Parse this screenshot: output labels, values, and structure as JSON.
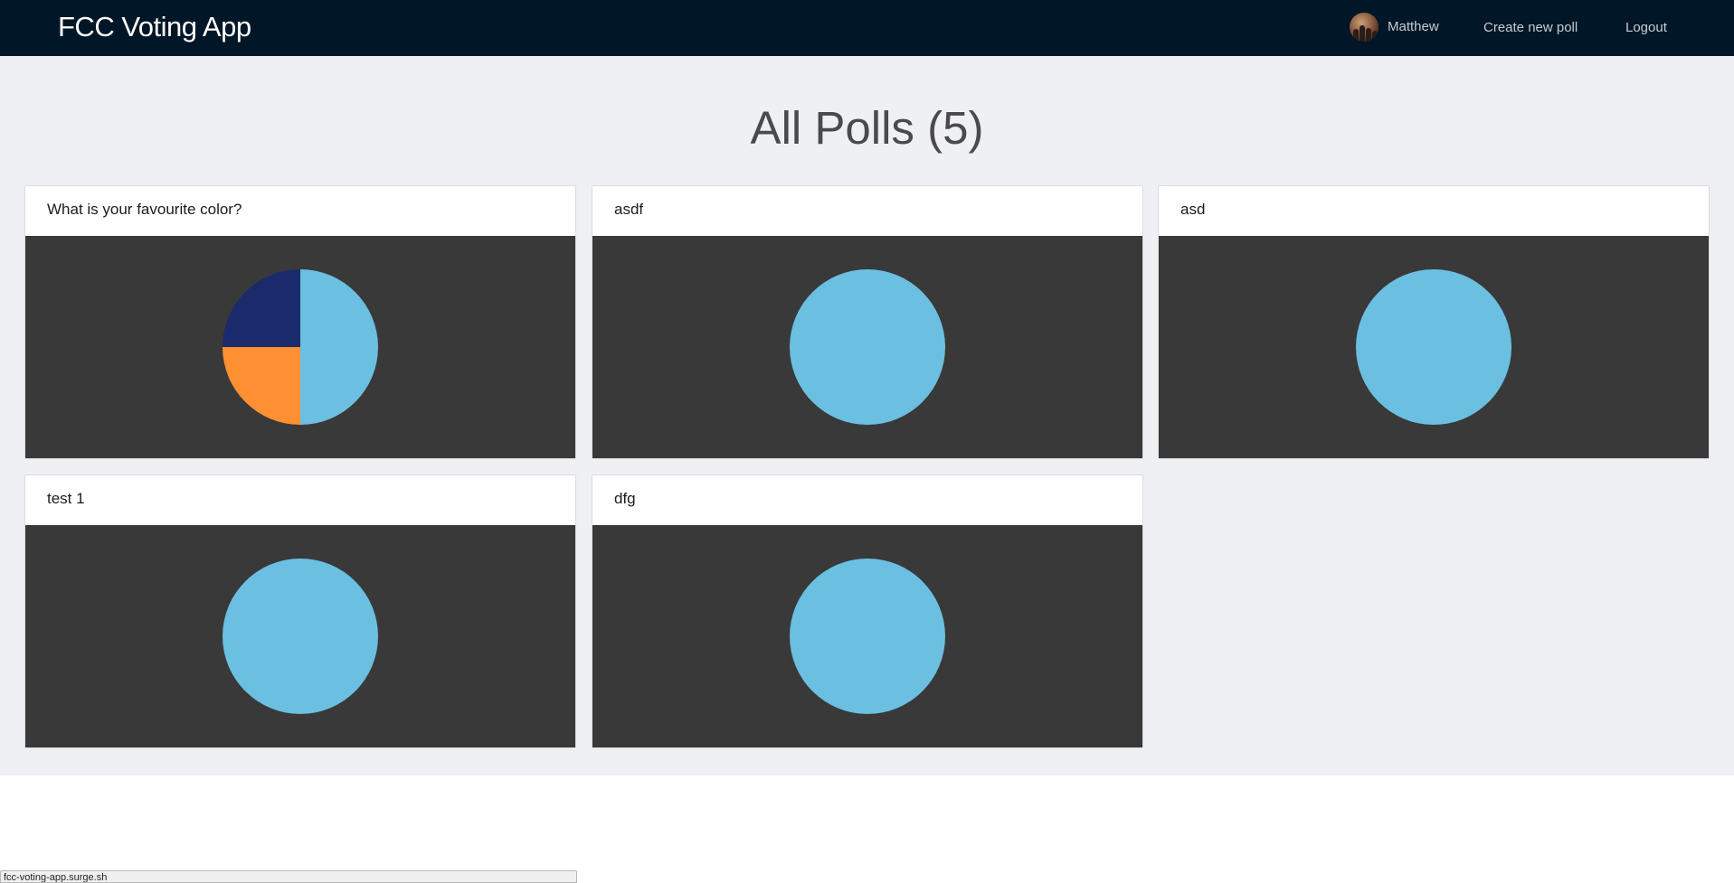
{
  "app": {
    "title": "FCC Voting App"
  },
  "nav": {
    "username": "Matthew",
    "create_poll_label": "Create new poll",
    "logout_label": "Logout",
    "avatar_icon": "user-avatar-photo"
  },
  "main": {
    "heading": "All Polls (5)"
  },
  "polls": [
    {
      "title": "What is your favourite color?",
      "chart_data": {
        "type": "pie",
        "values": [
          2,
          1,
          1
        ],
        "colors": [
          "#6bbfe0",
          "#ff8f33",
          "#1a2a6c"
        ]
      }
    },
    {
      "title": "asdf",
      "chart_data": {
        "type": "pie",
        "values": [
          1
        ],
        "colors": [
          "#6bbfe0"
        ]
      }
    },
    {
      "title": "asd",
      "chart_data": {
        "type": "pie",
        "values": [
          1
        ],
        "colors": [
          "#6bbfe0"
        ]
      }
    },
    {
      "title": "test 1",
      "chart_data": {
        "type": "pie",
        "values": [
          1
        ],
        "colors": [
          "#6bbfe0"
        ]
      }
    },
    {
      "title": "dfg",
      "chart_data": {
        "type": "pie",
        "values": [
          1
        ],
        "colors": [
          "#6bbfe0"
        ]
      }
    }
  ],
  "status_bar": {
    "url": "fcc-voting-app.surge.sh"
  },
  "colors": {
    "navbar_bg": "#011627",
    "page_bg": "#eff0f3",
    "chart_bg": "#393939"
  }
}
